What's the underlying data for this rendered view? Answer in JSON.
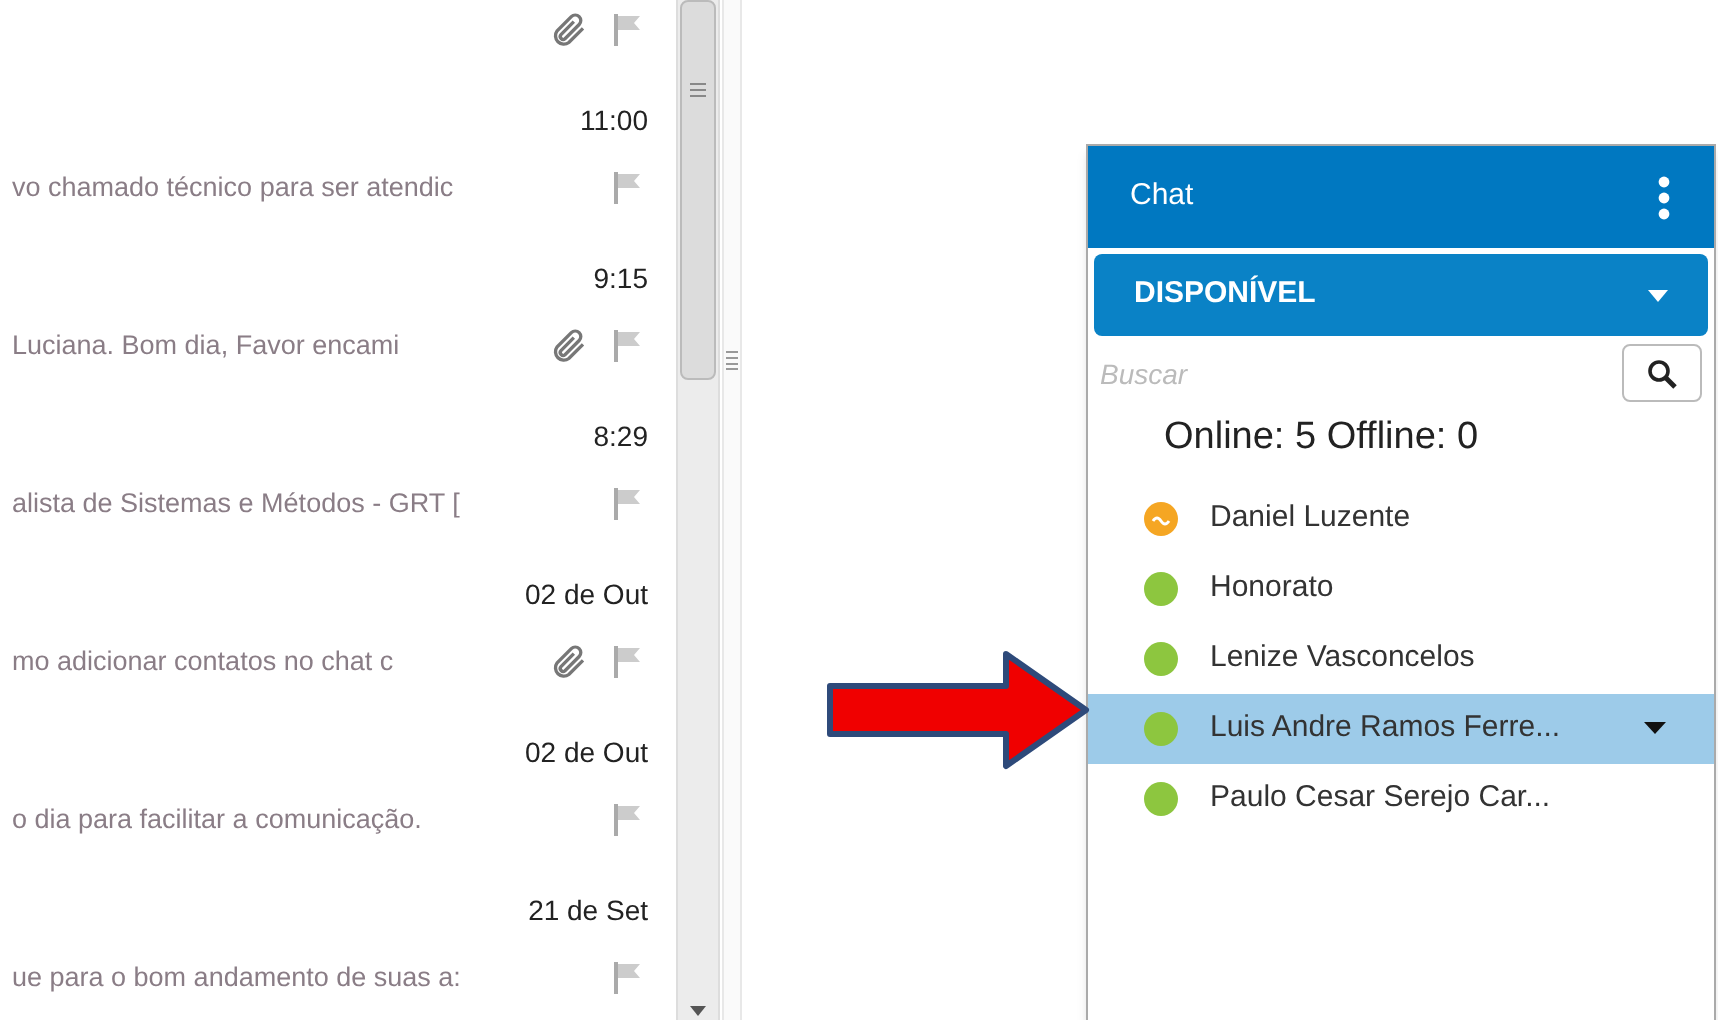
{
  "messages": [
    {
      "attachment": true
    },
    {
      "time": "11:00",
      "preview": "vo chamado técnico para ser atendic",
      "attachment": false
    },
    {
      "time": "9:15",
      "preview": "Luciana. Bom dia, Favor encami",
      "attachment": true
    },
    {
      "time": "8:29",
      "preview": "alista de Sistemas e Métodos - GRT [",
      "attachment": false
    },
    {
      "time": "02 de Out",
      "preview": "mo adicionar contatos no chat c",
      "attachment": true
    },
    {
      "time": "02 de Out",
      "preview": "o dia para facilitar a comunicação.",
      "attachment": false
    },
    {
      "time": "21 de Set",
      "preview": "ue para o bom andamento de suas a:",
      "attachment": false
    }
  ],
  "chat": {
    "title": "Chat",
    "status": "DISPONÍVEL",
    "search": {
      "placeholder": "Buscar"
    },
    "summary": "Online: 5 Offline: 0",
    "contacts": [
      {
        "name": "Daniel Luzente",
        "kind": "away",
        "color": "#f5a623",
        "selected": false
      },
      {
        "name": "Honorato",
        "kind": "online",
        "color": "#8dc63f",
        "selected": false
      },
      {
        "name": "Lenize Vasconcelos",
        "kind": "online",
        "color": "#8dc63f",
        "selected": false
      },
      {
        "name": "Luis Andre Ramos Ferre...",
        "kind": "online",
        "color": "#8dc63f",
        "selected": true
      },
      {
        "name": "Paulo Cesar Serejo Car...",
        "kind": "online",
        "color": "#8dc63f",
        "selected": false
      }
    ]
  }
}
